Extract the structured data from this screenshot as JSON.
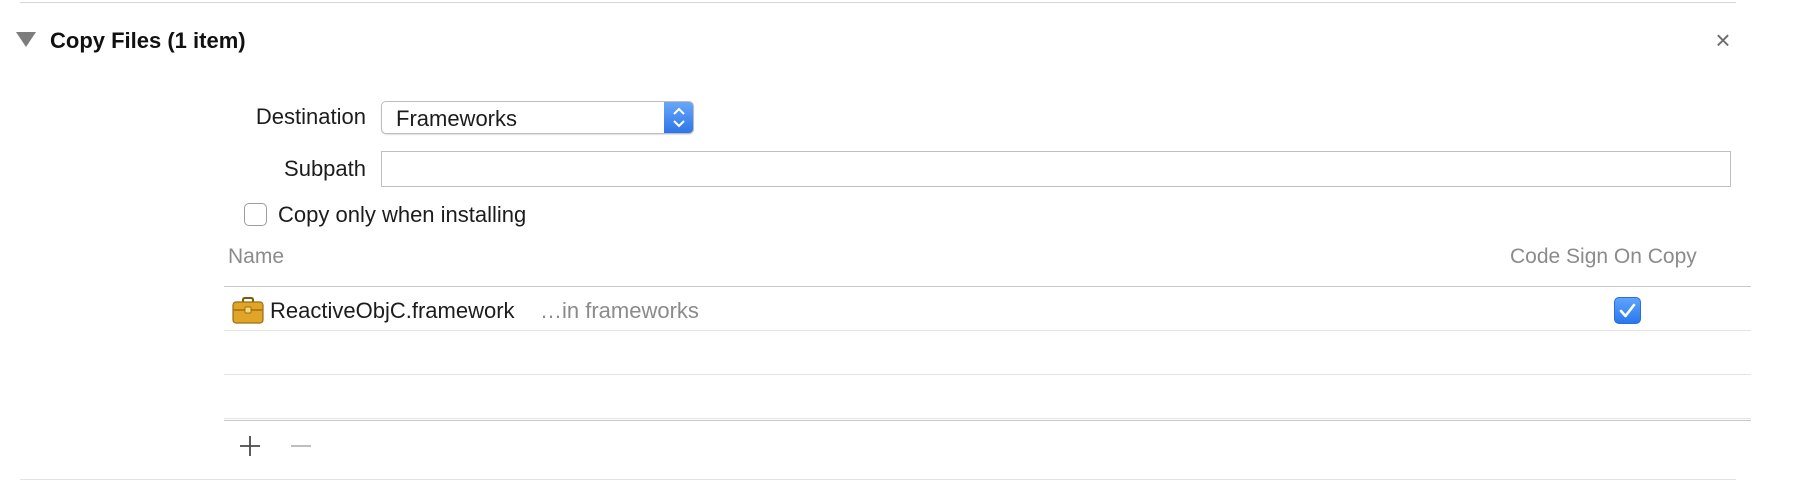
{
  "phase": {
    "title": "Copy Files (1 item)",
    "close_glyph": "×"
  },
  "form": {
    "destination_label": "Destination",
    "destination_value": "Frameworks",
    "subpath_label": "Subpath",
    "subpath_value": "",
    "copy_only_label": "Copy only when installing",
    "copy_only_checked": false
  },
  "table": {
    "columns": [
      "Name",
      "Code Sign On Copy"
    ],
    "rows": [
      {
        "name": "ReactiveObjC.framework",
        "location": "…in frameworks",
        "code_sign_on_copy": true,
        "icon": "toolbox-icon"
      }
    ]
  },
  "footer": {
    "add_icon": "plus-icon",
    "remove_icon": "minus-icon"
  },
  "colors": {
    "accent": "#2a78f0",
    "secondary_text": "#8b8b8b",
    "icon_gold": "#e0a526"
  }
}
